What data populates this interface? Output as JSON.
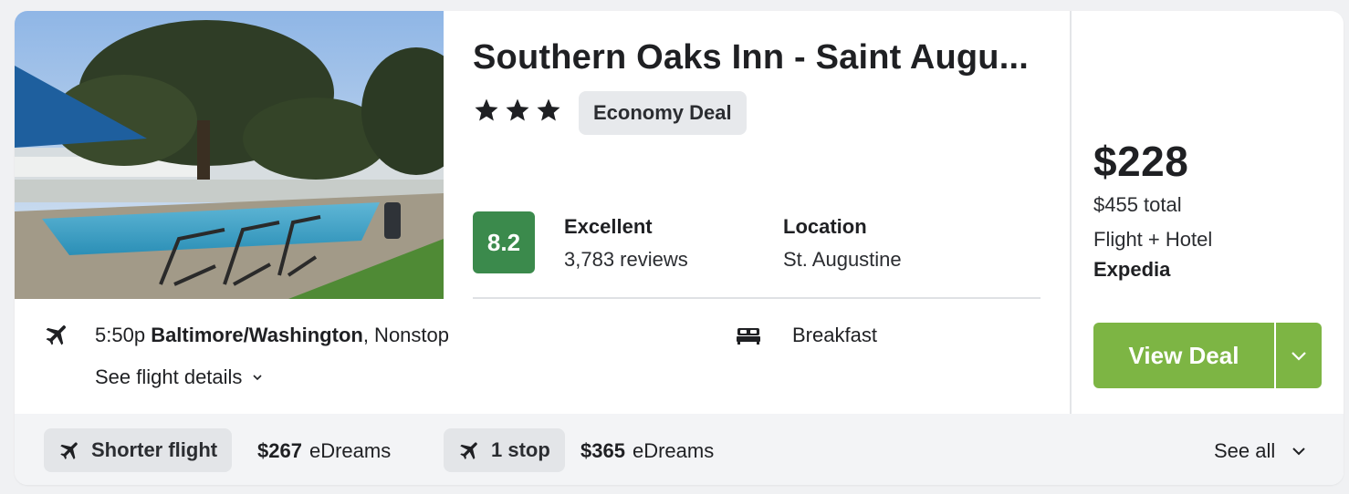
{
  "hotel": {
    "name": "Southern Oaks Inn - Saint Augu...",
    "stars": 3,
    "deal_badge": "Economy Deal",
    "score": "8.2",
    "rating_word": "Excellent",
    "reviews": "3,783 reviews",
    "location_label": "Location",
    "location_value": "St. Augustine"
  },
  "flight": {
    "time": "5:50p",
    "origin": "Baltimore/Washington",
    "stops": ", Nonstop",
    "details_link": "See flight details"
  },
  "amenity": {
    "label": "Breakfast",
    "icon": "bed-icon"
  },
  "pricing": {
    "price": "$228",
    "total": "$455 total",
    "package": "Flight + Hotel",
    "provider": "Expedia",
    "cta": "View Deal"
  },
  "alternatives": [
    {
      "label": "Shorter flight",
      "price": "$267",
      "provider": "eDreams",
      "icon": "plane-icon"
    },
    {
      "label": "1 stop",
      "price": "$365",
      "provider": "eDreams",
      "icon": "plane-icon"
    }
  ],
  "see_all": "See all",
  "colors": {
    "score_bg": "#3b8a4c",
    "cta_bg": "#7db544",
    "badge_bg": "#e7e9ec"
  }
}
